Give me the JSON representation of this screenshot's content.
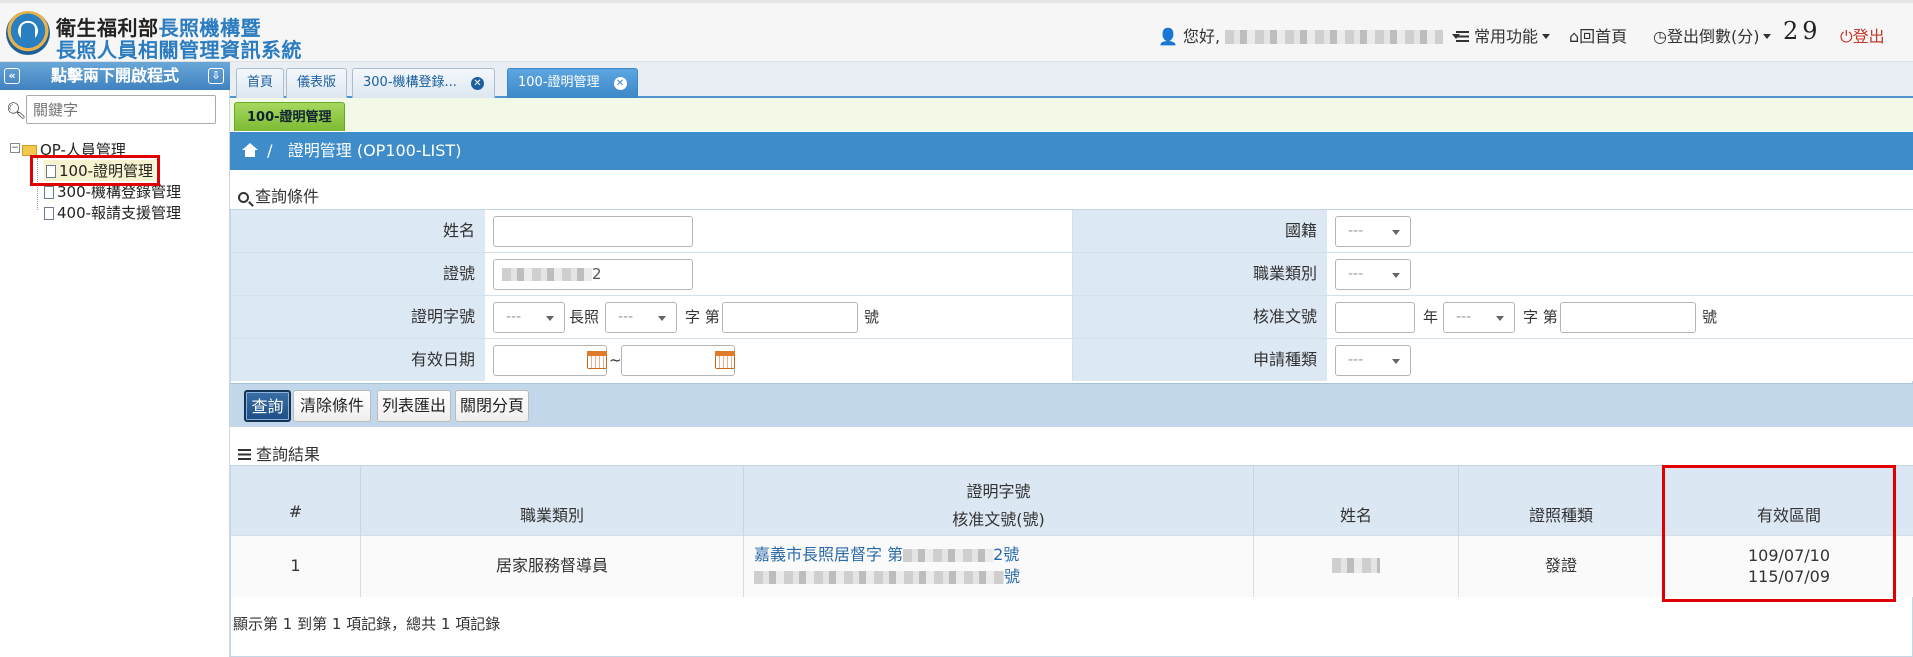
{
  "header": {
    "title_part1": "衛生福利部",
    "title_part2": "長照機構暨",
    "title_line2": "長照人員相關管理資訊系統",
    "greeting": "您好,",
    "common_functions": "常用功能",
    "home": "回首頁",
    "logout_countdown_label": "登出倒數(分)",
    "logout_countdown_value": "29",
    "logout": "登出"
  },
  "sidebar": {
    "title": "點擊兩下開啟程式",
    "search_placeholder": "關鍵字",
    "tree_root": "OP-人員管理",
    "items": [
      {
        "label": "100-證明管理"
      },
      {
        "label": "300-機構登錄管理"
      },
      {
        "label": "400-報請支援管理"
      }
    ]
  },
  "tabs": [
    {
      "label": "首頁"
    },
    {
      "label": "儀表版"
    },
    {
      "label": "300-機構登錄..."
    },
    {
      "label": "100-證明管理"
    }
  ],
  "subtab": "100-證明管理",
  "breadcrumb": {
    "separator": "/",
    "page": "證明管理 (OP100-LIST)"
  },
  "query": {
    "title": "查詢條件",
    "fields": {
      "name_label": "姓名",
      "nationality_label": "國籍",
      "nationality_value": "---",
      "id_label": "證號",
      "id_value_tail": "2",
      "profession_label": "職業類別",
      "profession_value": "---",
      "cert_no_label": "證明字號",
      "cert_no_select1": "---",
      "cert_no_text1": "長照",
      "cert_no_select2": "---",
      "cert_no_text2": "字 第",
      "cert_no_text3": "號",
      "approval_label": "核准文號",
      "approval_text1": "年",
      "approval_select": "---",
      "approval_text2": "字 第",
      "approval_text3": "號",
      "valid_date_label": "有效日期",
      "valid_date_sep": "~",
      "apply_type_label": "申請種類",
      "apply_type_value": "---"
    },
    "buttons": {
      "search": "查詢",
      "clear": "清除條件",
      "export": "列表匯出",
      "close_paging": "關閉分頁"
    }
  },
  "results": {
    "title": "查詢結果",
    "columns": {
      "index": "#",
      "profession": "職業類別",
      "cert_no_line1": "證明字號",
      "cert_no_line2": "核准文號(號)",
      "name": "姓名",
      "license_type": "證照種類",
      "valid_range": "有效區間"
    },
    "rows": [
      {
        "index": "1",
        "profession": "居家服務督導員",
        "cert_prefix": "嘉義市長照居督字 第",
        "cert_suffix": "2號",
        "approval_suffix": "號",
        "name_visible": "",
        "license_type": "發證",
        "valid_from": "109/07/10",
        "valid_to": "115/07/09"
      }
    ],
    "pager": "顯示第 1 到第 1 項記錄，總共 1 項記錄"
  },
  "colors": {
    "accent": "#3e8cc9",
    "label_bg": "#dce8f3",
    "highlight": "#e00000",
    "subtab": "#7dbb35"
  }
}
